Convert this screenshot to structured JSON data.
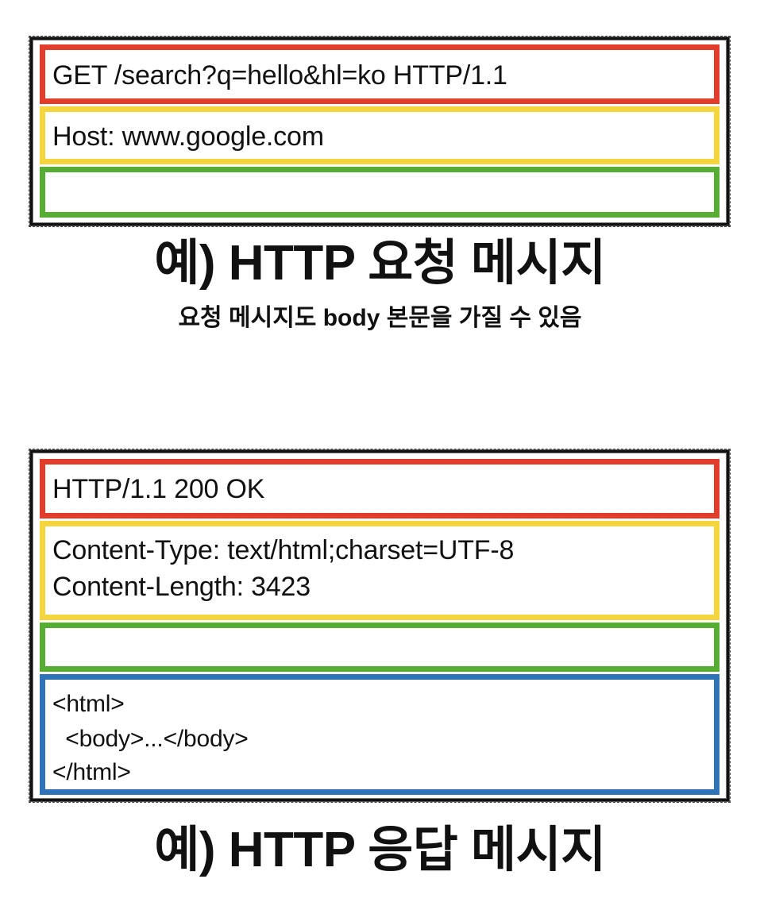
{
  "request": {
    "start_line": "GET /search?q=hello&hl=ko HTTP/1.1",
    "header_line": "Host: www.google.com",
    "caption": "예) HTTP 요청 메시지",
    "note": "요청 메시지도 body 본문을 가질 수 있음"
  },
  "response": {
    "status_line": "HTTP/1.1 200 OK",
    "header_line_1": "Content-Type: text/html;charset=UTF-8",
    "header_line_2": "Content-Length: 3423",
    "body_line_1": "<html>",
    "body_line_2": "  <body>...</body>",
    "body_line_3": "</html>",
    "caption": "예) HTTP 응답 메시지"
  },
  "colors": {
    "start_line": "#e23d2b",
    "headers": "#f5d53e",
    "empty_line": "#55ad34",
    "body": "#2e72b8"
  }
}
